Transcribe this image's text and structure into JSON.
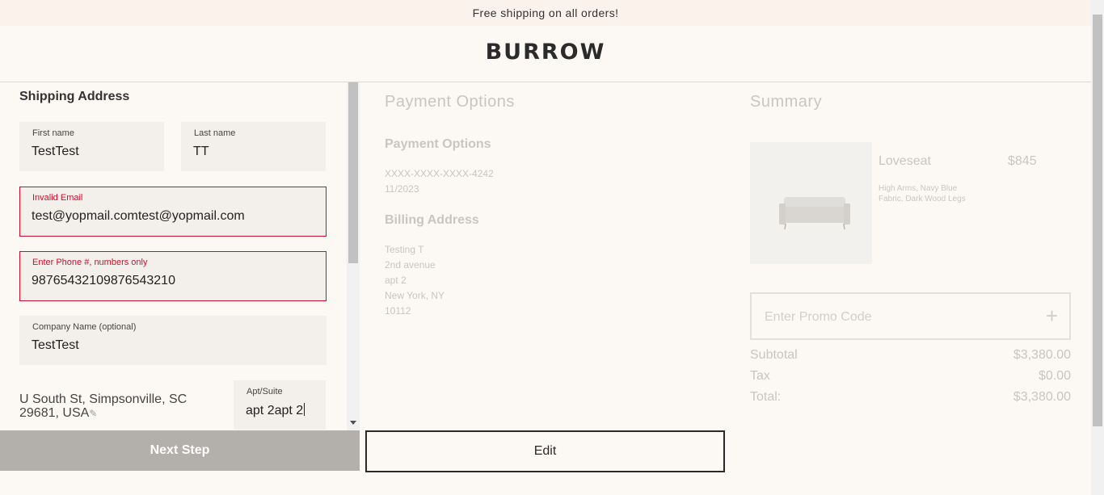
{
  "banner": {
    "text": "Free shipping on all orders!"
  },
  "header": {
    "logo": "BURROW"
  },
  "shipping": {
    "title": "Shipping Address",
    "first_name": {
      "label": "First name",
      "value": "TestTest"
    },
    "last_name": {
      "label": "Last name",
      "value": "TT"
    },
    "email": {
      "label": "Invalid Email",
      "value": "test@yopmail.comtest@yopmail.com"
    },
    "phone": {
      "label": "Enter Phone #, numbers only",
      "value": "98765432109876543210"
    },
    "company": {
      "label": "Company Name (optional)",
      "value": "TestTest"
    },
    "address": {
      "line1": "U South St, Simpsonville, SC",
      "line2": "29681, USA"
    },
    "apt": {
      "label": "Apt/Suite",
      "value": "apt 2apt 2"
    },
    "next_button": "Next Step"
  },
  "payment": {
    "title": "Payment Options",
    "subtitle": "Payment Options",
    "card_number": "XXXX-XXXX-XXXX-4242",
    "card_expiry": "11/2023",
    "billing_title": "Billing Address",
    "billing_lines": [
      "Testing T",
      "2nd avenue",
      "apt 2",
      "New York, NY",
      "10112"
    ],
    "edit_button": "Edit"
  },
  "summary": {
    "title": "Summary",
    "product": {
      "name": "Loveseat",
      "price": "$845",
      "details_line1": "High Arms, Navy Blue",
      "details_line2": "Fabric, Dark Wood Legs"
    },
    "promo_placeholder": "Enter Promo Code",
    "subtotal_label": "Subtotal",
    "subtotal_value": "$3,380.00",
    "tax_label": "Tax",
    "tax_value": "$0.00",
    "total_label": "Total:",
    "total_value": "$3,380.00"
  },
  "colors": {
    "background": "#fcf9f4",
    "error": "#c8102e",
    "button_disabled": "#b3afab",
    "faded_text": "#c9c5c0"
  },
  "icons": [
    "pencil-icon",
    "plus-icon",
    "sofa-image"
  ]
}
